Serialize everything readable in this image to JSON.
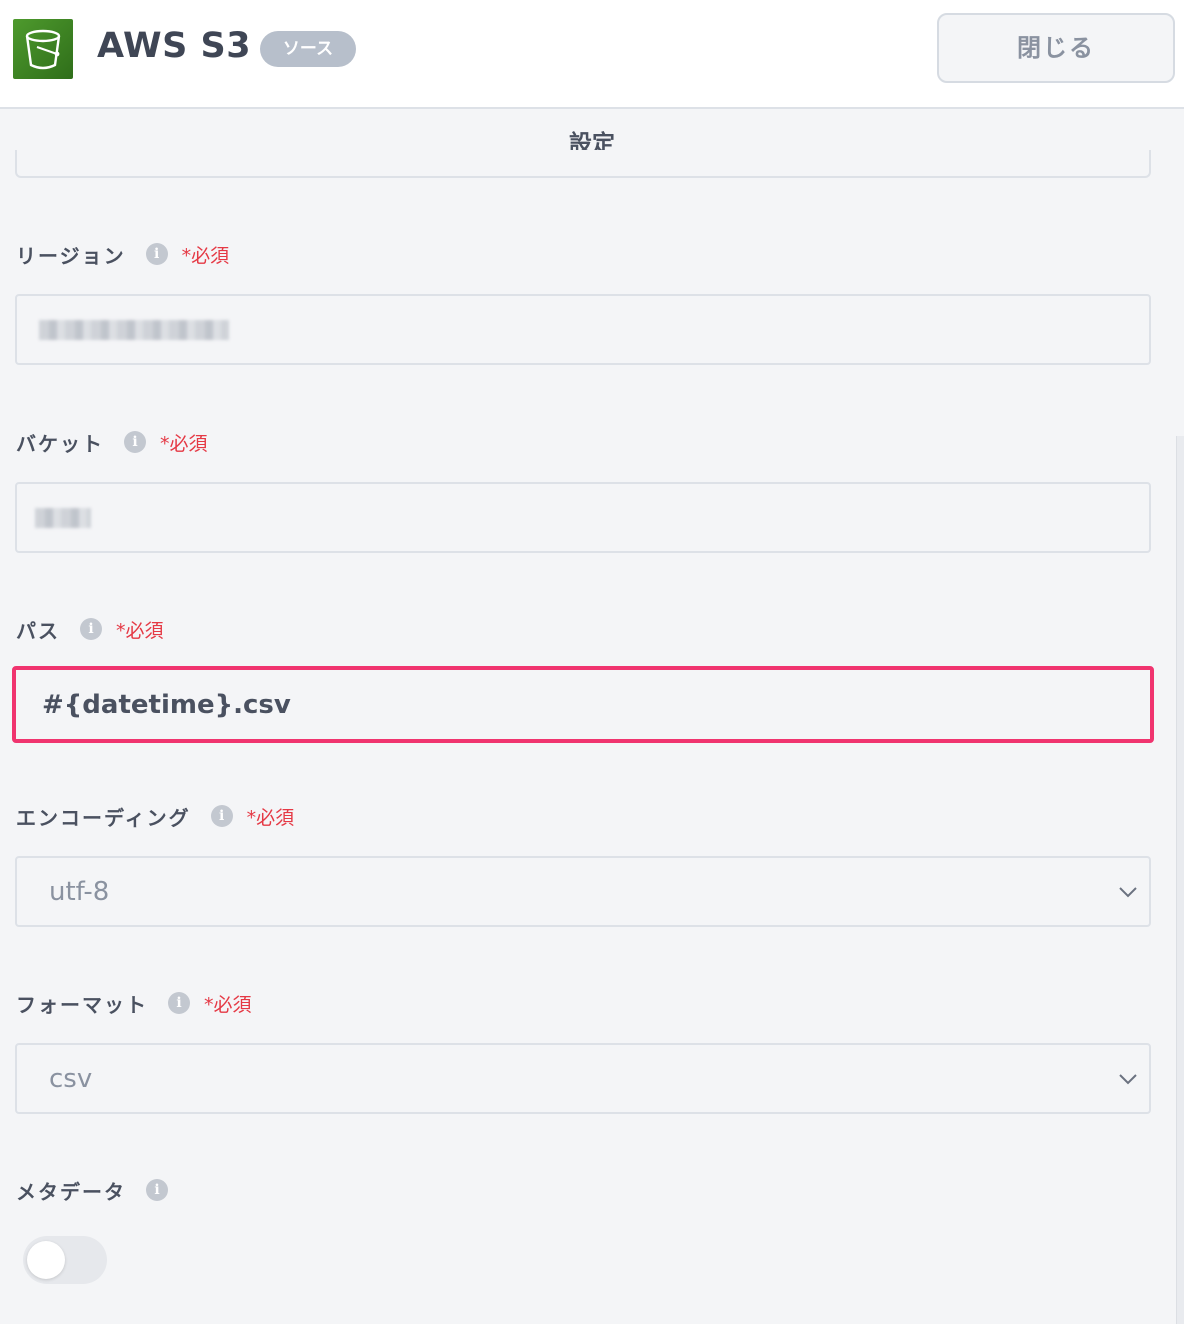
{
  "header": {
    "app_title": "AWS S3",
    "badge": "ソース",
    "close_label": "閉じる",
    "logo_icon": "s3-bucket-icon",
    "brand_color": "#3f8624"
  },
  "section": {
    "title": "設定"
  },
  "fields": {
    "region": {
      "label": "リージョン",
      "required": "*必須",
      "value_state": "redacted"
    },
    "bucket": {
      "label": "バケット",
      "required": "*必須",
      "value_state": "redacted"
    },
    "path": {
      "label": "パス",
      "required": "*必須",
      "value": "#{datetime}.csv",
      "highlight_color": "#f0346f"
    },
    "encoding": {
      "label": "エンコーディング",
      "required": "*必須",
      "value": "utf-8"
    },
    "format": {
      "label": "フォーマット",
      "required": "*必須",
      "value": "csv"
    },
    "metadata": {
      "label": "メタデータ",
      "toggle_on": false
    }
  },
  "icons": {
    "info": "info-icon",
    "chevron": "chevron-down-icon"
  },
  "colors": {
    "required": "#e53945",
    "background": "#f4f5f7"
  }
}
